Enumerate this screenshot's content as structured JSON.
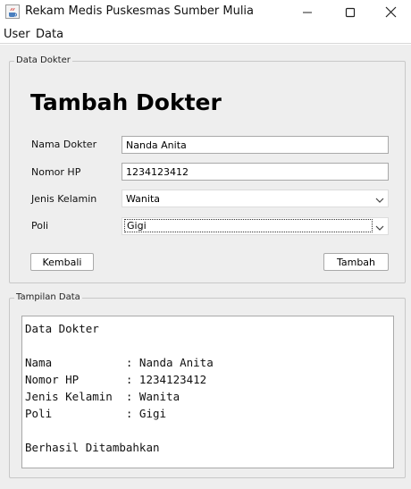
{
  "window": {
    "title": "Rekam Medis Puskesmas Sumber Mulia",
    "app_icon": "java-cup-icon",
    "controls": [
      "minimize-icon",
      "maximize-icon",
      "close-icon"
    ]
  },
  "menu": {
    "items": [
      "User",
      "Data"
    ]
  },
  "form_group": {
    "title": "Data Dokter",
    "heading": "Tambah Dokter",
    "fields": {
      "nama": {
        "label": "Nama Dokter",
        "value": "Nanda Anita"
      },
      "nomor_hp": {
        "label": "Nomor HP",
        "value": "1234123412"
      },
      "jenis_kelamin": {
        "label": "Jenis Kelamin",
        "value": "Wanita"
      },
      "poli": {
        "label": "Poli",
        "value": "Gigi"
      }
    },
    "buttons": {
      "back": "Kembali",
      "add": "Tambah"
    }
  },
  "output_group": {
    "title": "Tampilan Data",
    "text": "Data Dokter\n\nNama           : Nanda Anita\nNomor HP       : 1234123412\nJenis Kelamin  : Wanita\nPoli           : Gigi\n\nBerhasil Ditambahkan"
  },
  "colors": {
    "panel_background": "#eeeeee",
    "border": "#a9a9a9"
  }
}
